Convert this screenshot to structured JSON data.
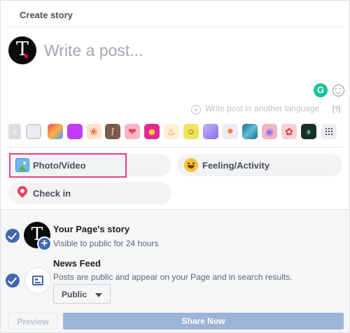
{
  "header": {
    "title": "Create story"
  },
  "author": {
    "avatar_letter": "T"
  },
  "composer": {
    "placeholder": "Write a post..."
  },
  "language": {
    "label": "Write post in another language",
    "help": "[?]"
  },
  "colors": {
    "accent": "#4267b2",
    "highlight": "#ea3e80",
    "share_disabled": "#9cb4d8"
  },
  "background_picker": {
    "items": [
      {
        "name": "plain",
        "color": "#ebedf0"
      },
      {
        "name": "rainbow",
        "color": "#ff3f6c"
      },
      {
        "name": "purple",
        "color": "#c13cf3"
      },
      {
        "name": "orange-leaves",
        "color": "#f0885a"
      },
      {
        "name": "brown-pattern",
        "color": "#7c5b4a"
      },
      {
        "name": "red-heart",
        "color": "#e9415e"
      },
      {
        "name": "heart-eyes-emoji",
        "color": "#e12b8c"
      },
      {
        "name": "fire",
        "color": "#f6a623"
      },
      {
        "name": "cat",
        "color": "#f0e35b"
      },
      {
        "name": "lavender",
        "color": "#a58df0"
      },
      {
        "name": "orange-fruit",
        "color": "#f59c4a"
      },
      {
        "name": "teal-splash",
        "color": "#3d8ea8"
      },
      {
        "name": "pink-eye",
        "color": "#f2b5c4"
      },
      {
        "name": "rose",
        "color": "#d93a43"
      },
      {
        "name": "cactus",
        "color": "#1a2e2a"
      }
    ]
  },
  "actions": {
    "photo": "Photo/Video",
    "feeling": "Feeling/Activity",
    "checkin": "Check in"
  },
  "destinations": {
    "story_title": "Your Page's story",
    "story_sub": "Visible to public for 24 hours",
    "feed_title": "News Feed",
    "feed_sub": "Posts are public and appear on your Page and in search results.",
    "audience": "Public"
  },
  "footer": {
    "preview": "Preview",
    "share": "Share Now"
  }
}
